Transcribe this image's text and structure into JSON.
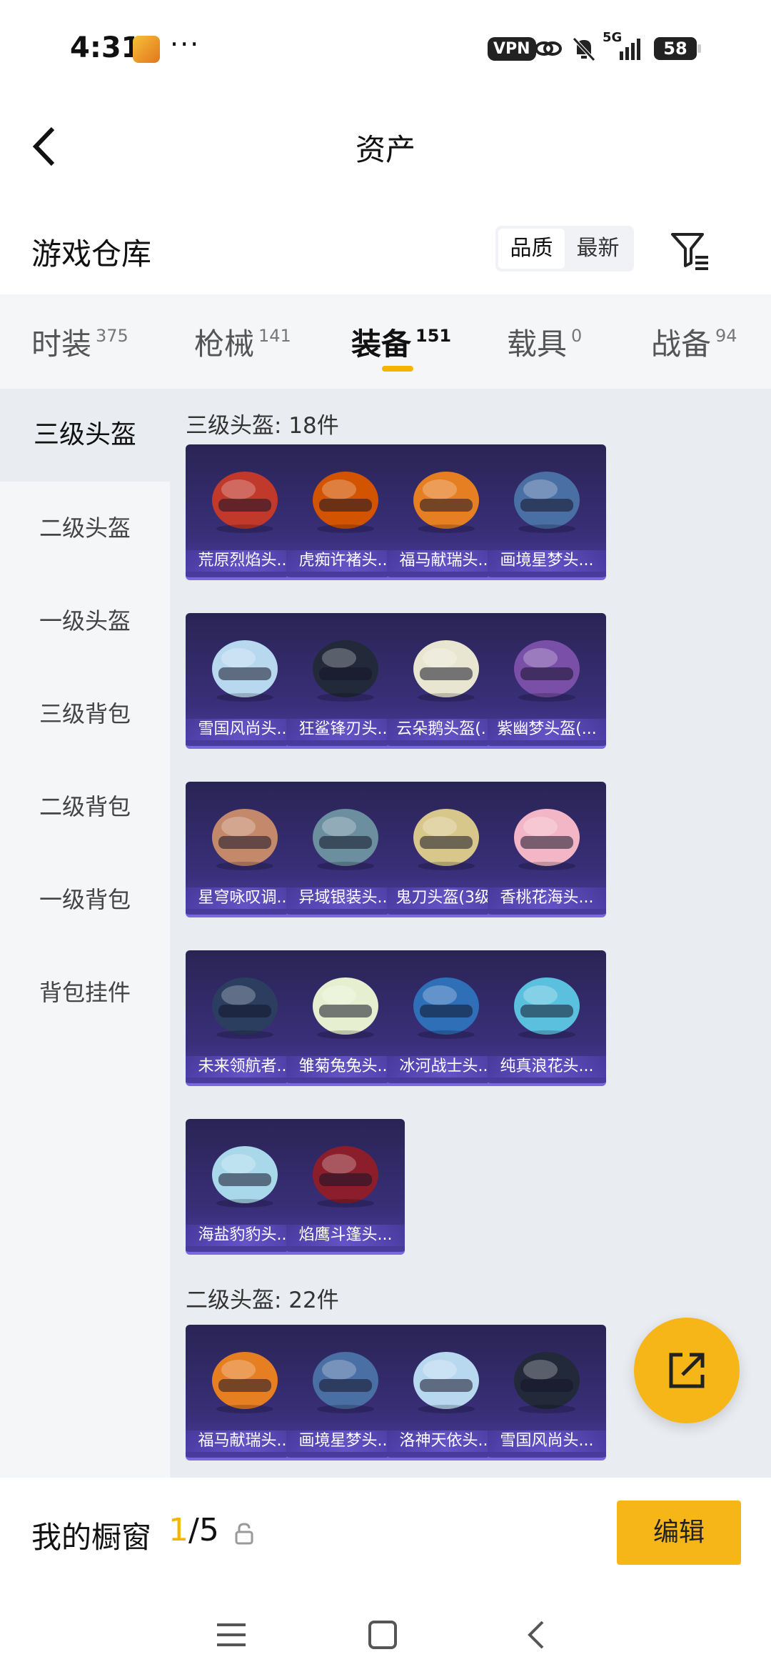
{
  "status_bar": {
    "time": "4:31",
    "dots": "···",
    "vpn": "VPN",
    "network": "5G",
    "battery": "58"
  },
  "header": {
    "title": "资产"
  },
  "warehouse": {
    "title": "游戏仓库",
    "sort_options": [
      "品质",
      "最新"
    ]
  },
  "tabs": [
    {
      "label": "时装",
      "count": "375"
    },
    {
      "label": "枪械",
      "count": "141"
    },
    {
      "label": "装备",
      "count": "151"
    },
    {
      "label": "载具",
      "count": "0"
    },
    {
      "label": "战备",
      "count": "94"
    }
  ],
  "sidebar": {
    "items": [
      "三级头盔",
      "二级头盔",
      "一级头盔",
      "三级背包",
      "二级背包",
      "一级背包",
      "背包挂件"
    ]
  },
  "sections": [
    {
      "title": "三级头盔: 18件",
      "items": [
        "荒原烈焰头...",
        "虎痴许褚头...",
        "福马献瑞头...",
        "画境星梦头...",
        "雪国风尚头...",
        "狂鲨锋刃头...",
        "云朵鹅头盔(...",
        "紫幽梦头盔(...",
        "星穹咏叹调...",
        "异域银装头...",
        "鬼刀头盔(3级)",
        "香桃花海头...",
        "未来领航者...",
        "雏菊兔兔头...",
        "冰河战士头...",
        "纯真浪花头...",
        "海盐豹豹头...",
        "焰鹰斗篷头..."
      ]
    },
    {
      "title": "二级头盔: 22件",
      "items": [
        "福马献瑞头...",
        "画境星梦头...",
        "洛神天依头...",
        "雪国风尚头..."
      ]
    }
  ],
  "bottom_bar": {
    "label": "我的橱窗",
    "count_current": "1",
    "count_total": "/5",
    "edit_label": "编辑"
  },
  "colors": {
    "accent": "#f7b618",
    "card_bg": "#2f2865",
    "card_border": "#7b67e0"
  }
}
